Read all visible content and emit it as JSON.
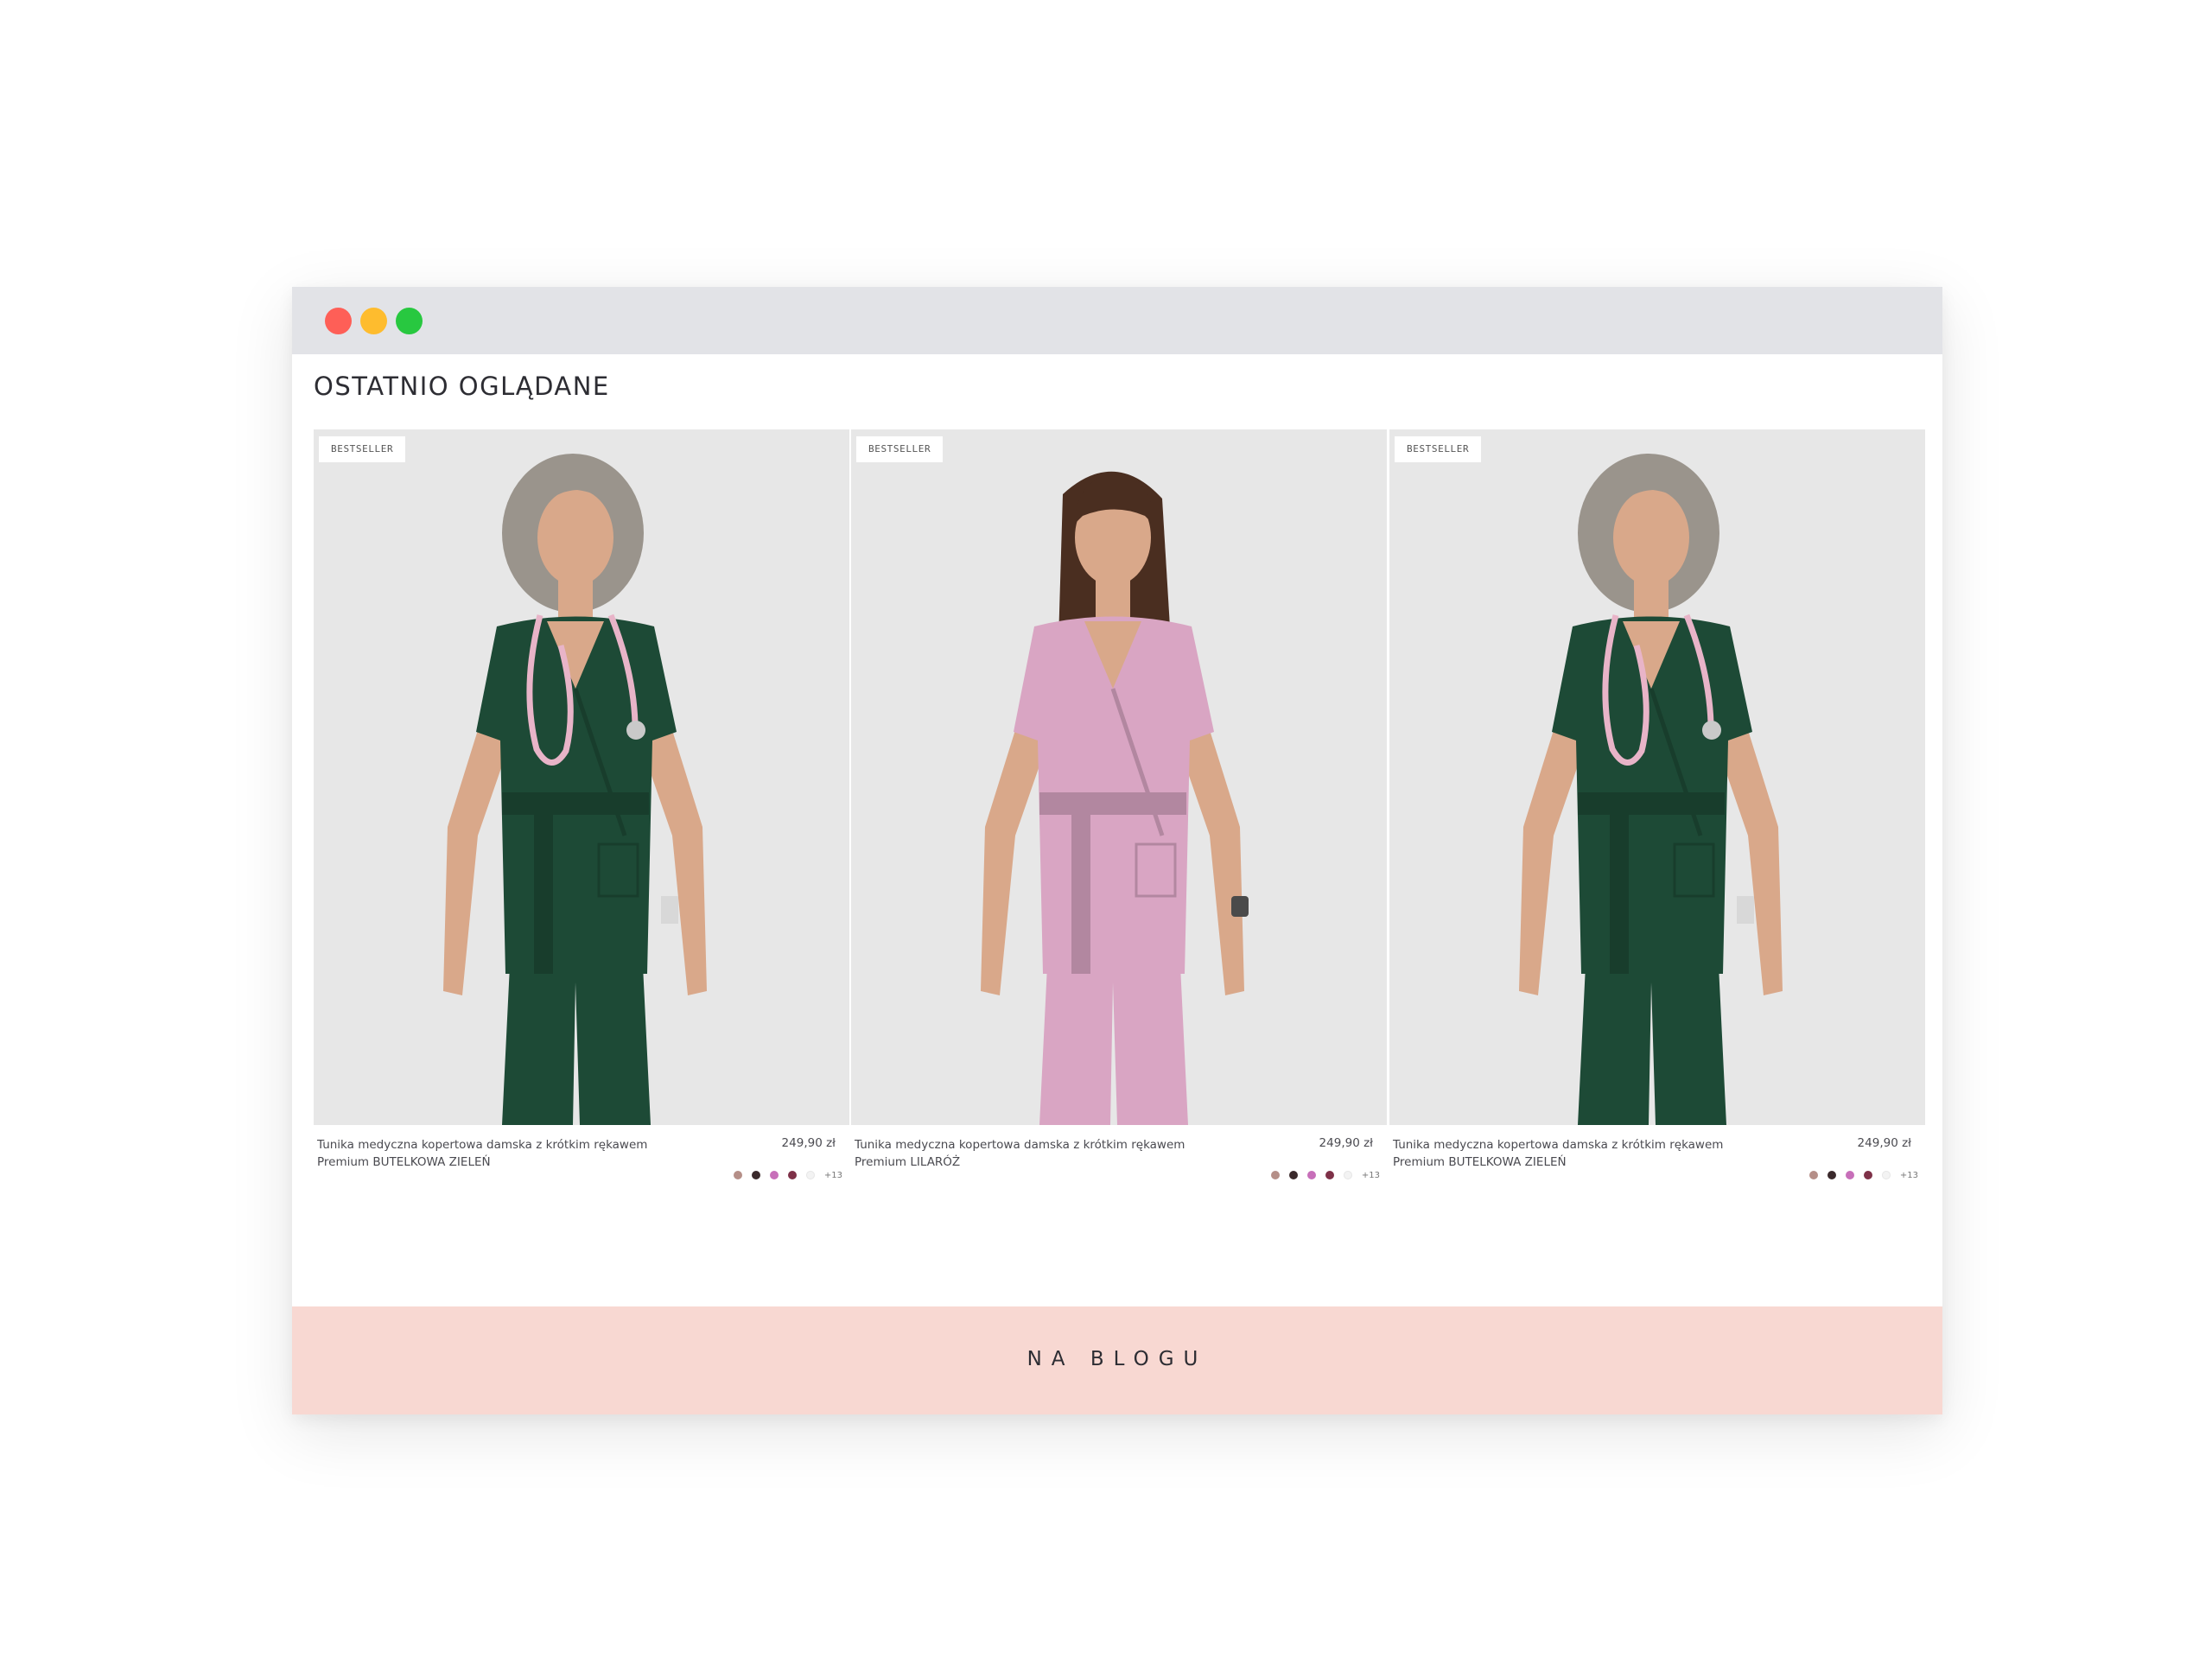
{
  "window": {
    "controls": [
      {
        "name": "close",
        "color": "#fe5f57"
      },
      {
        "name": "minimize",
        "color": "#febc2e"
      },
      {
        "name": "maximize",
        "color": "#28c840"
      }
    ]
  },
  "section": {
    "title": "OSTATNIO OGLĄDANE"
  },
  "products": [
    {
      "badge": "BESTSELLER",
      "name": "Tunika medyczna kopertowa damska z krótkim rękawem Premium BUTELKOWA ZIELEŃ",
      "price": "249,90 zł",
      "garment_color": "#1d4a36",
      "model_hair": "grey-curly",
      "accessory": "stethoscope",
      "swatches": [
        "#b58f88",
        "#3b2a2c",
        "#c76fb9",
        "#7e3148",
        "#f3f3f3"
      ],
      "more_colors": "+13"
    },
    {
      "badge": "BESTSELLER",
      "name": "Tunika medyczna kopertowa damska z krótkim rękawem Premium LILARÓŻ",
      "price": "249,90 zł",
      "garment_color": "#d9a5c3",
      "model_hair": "brown-straight",
      "accessory": "watch",
      "swatches": [
        "#b58f88",
        "#3b2a2c",
        "#c76fb9",
        "#7e3148",
        "#f3f3f3"
      ],
      "more_colors": "+13"
    },
    {
      "badge": "BESTSELLER",
      "name": "Tunika medyczna kopertowa damska z krótkim rękawem Premium BUTELKOWA ZIELEŃ",
      "price": "249,90 zł",
      "garment_color": "#1d4a36",
      "model_hair": "grey-curly",
      "accessory": "stethoscope",
      "swatches": [
        "#b58f88",
        "#3b2a2c",
        "#c76fb9",
        "#7e3148",
        "#f3f3f3"
      ],
      "more_colors": "+13"
    }
  ],
  "blog": {
    "title": "NA BLOGU",
    "background": "#f8d8d2"
  }
}
